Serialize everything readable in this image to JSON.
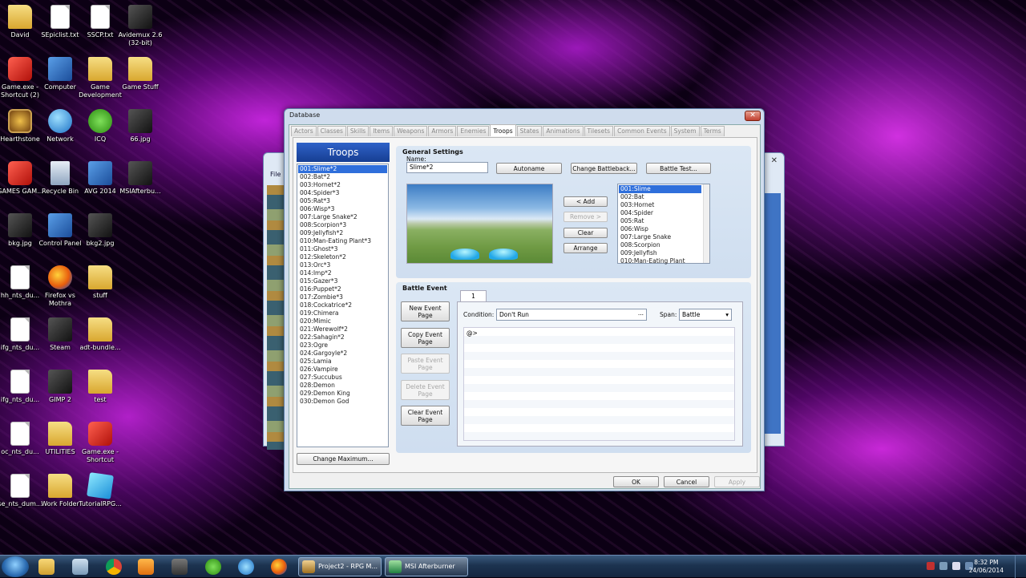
{
  "desktop": {
    "icons": [
      {
        "label": "David",
        "icon": "folder-icon"
      },
      {
        "label": "SEpiclist.txt",
        "icon": "text-file-icon"
      },
      {
        "label": "SSCP.txt",
        "icon": "text-file-icon"
      },
      {
        "label": "Avidemux 2.6 (32-bit)",
        "icon": "clapperboard-icon"
      },
      {
        "label": "Game.exe - Shortcut (2)",
        "icon": "game-exe-icon"
      },
      {
        "label": "Computer",
        "icon": "computer-icon"
      },
      {
        "label": "Game Development",
        "icon": "folder-icon"
      },
      {
        "label": "Game Stuff",
        "icon": "folder-icon"
      },
      {
        "label": "Hearthstone",
        "icon": "hearthstone-icon"
      },
      {
        "label": "Network",
        "icon": "network-icon"
      },
      {
        "label": "ICQ",
        "icon": "icq-flower-icon"
      },
      {
        "label": "66.jpg",
        "icon": "image-file-icon"
      },
      {
        "label": "GAMES GAM...",
        "icon": "power-button-icon"
      },
      {
        "label": "Recycle Bin",
        "icon": "recycle-bin-icon"
      },
      {
        "label": "AVG 2014",
        "icon": "avg-icon"
      },
      {
        "label": "MSIAfterbu...",
        "icon": "winrar-archive-icon"
      },
      {
        "label": "bkg.jpg",
        "icon": "image-file-icon"
      },
      {
        "label": "Control Panel",
        "icon": "control-panel-icon"
      },
      {
        "label": "bkg2.jpg",
        "icon": "image-file-icon"
      },
      {
        "label": "hh_nts_du...",
        "icon": "text-file-icon"
      },
      {
        "label": "Firefox vs Mothra",
        "icon": "firefox-icon"
      },
      {
        "label": "stuff",
        "icon": "folder-icon"
      },
      {
        "label": "ifg_nts_du...",
        "icon": "text-file-icon"
      },
      {
        "label": "Steam",
        "icon": "steam-icon"
      },
      {
        "label": "adt-bundle...",
        "icon": "folder-icon"
      },
      {
        "label": "ifg_nts_du...",
        "icon": "text-file-icon"
      },
      {
        "label": "GIMP 2",
        "icon": "gimp-icon"
      },
      {
        "label": "test",
        "icon": "folder-icon"
      },
      {
        "label": "oc_nts_du...",
        "icon": "text-file-icon"
      },
      {
        "label": "UTILITIES",
        "icon": "folder-icon"
      },
      {
        "label": "Game.exe - Shortcut",
        "icon": "game-exe-icon"
      },
      {
        "label": "se_nts_dum...",
        "icon": "text-file-icon"
      },
      {
        "label": "Work Folder",
        "icon": "folder-icon"
      },
      {
        "label": "TutorialRPG...",
        "icon": "cube-icon"
      }
    ]
  },
  "bg_window": {
    "menu_label": "File"
  },
  "dialog": {
    "title": "Database",
    "close_label": "✕",
    "tabs": [
      "Actors",
      "Classes",
      "Skills",
      "Items",
      "Weapons",
      "Armors",
      "Enemies",
      "Troops",
      "States",
      "Animations",
      "Tilesets",
      "Common Events",
      "System",
      "Terms"
    ],
    "active_tab": "Troops",
    "list_header": "Troops",
    "troops": [
      "001:Slime*2",
      "002:Bat*2",
      "003:Hornet*2",
      "004:Spider*3",
      "005:Rat*3",
      "006:Wisp*3",
      "007:Large Snake*2",
      "008:Scorpion*3",
      "009:Jellyfish*2",
      "010:Man-Eating Plant*3",
      "011:Ghost*3",
      "012:Skeleton*2",
      "013:Orc*3",
      "014:Imp*2",
      "015:Gazer*3",
      "016:Puppet*2",
      "017:Zombie*3",
      "018:Cockatrice*2",
      "019:Chimera",
      "020:Mimic",
      "021:Werewolf*2",
      "022:Sahagin*2",
      "023:Ogre",
      "024:Gargoyle*2",
      "025:Lamia",
      "026:Vampire",
      "027:Succubus",
      "028:Demon",
      "029:Demon King",
      "030:Demon God"
    ],
    "selected_troop_index": 0,
    "change_max_label": "Change Maximum...",
    "general": {
      "title": "General Settings",
      "name_label": "Name:",
      "name_value": "Slime*2",
      "autoname_label": "Autoname",
      "change_battleback_label": "Change Battleback...",
      "battle_test_label": "Battle Test...",
      "add_label": "< Add",
      "remove_label": "Remove >",
      "clear_label": "Clear",
      "arrange_label": "Arrange",
      "enemies": [
        "001:Slime",
        "002:Bat",
        "003:Hornet",
        "004:Spider",
        "005:Rat",
        "006:Wisp",
        "007:Large Snake",
        "008:Scorpion",
        "009:Jellyfish",
        "010:Man-Eating Plant"
      ],
      "selected_enemy_index": 0
    },
    "battle_event": {
      "title": "Battle Event",
      "new_page_label": "New Event Page",
      "copy_page_label": "Copy Event Page",
      "paste_page_label": "Paste Event Page",
      "delete_page_label": "Delete Event Page",
      "clear_page_label": "Clear Event Page",
      "page_tab": "1",
      "condition_label": "Condition:",
      "condition_value": "Don't Run",
      "condition_ellipsis": "...",
      "span_label": "Span:",
      "span_value": "Battle",
      "span_arrow": "▾",
      "command_line": "@>"
    },
    "ok_label": "OK",
    "cancel_label": "Cancel",
    "apply_label": "Apply"
  },
  "taskbar": {
    "tasks": [
      {
        "label": "Project2 - RPG M...",
        "icon": "rpg-maker-icon"
      },
      {
        "label": "MSI Afterburner",
        "icon": "msi-afterburner-icon"
      }
    ],
    "time": "8:32 PM",
    "date": "24/06/2014"
  },
  "colors": {
    "selection": "#2f6fdb",
    "list_header": "#163e92",
    "panel": "#d4e2f2",
    "wallpaper_accent": "#c024d8"
  }
}
